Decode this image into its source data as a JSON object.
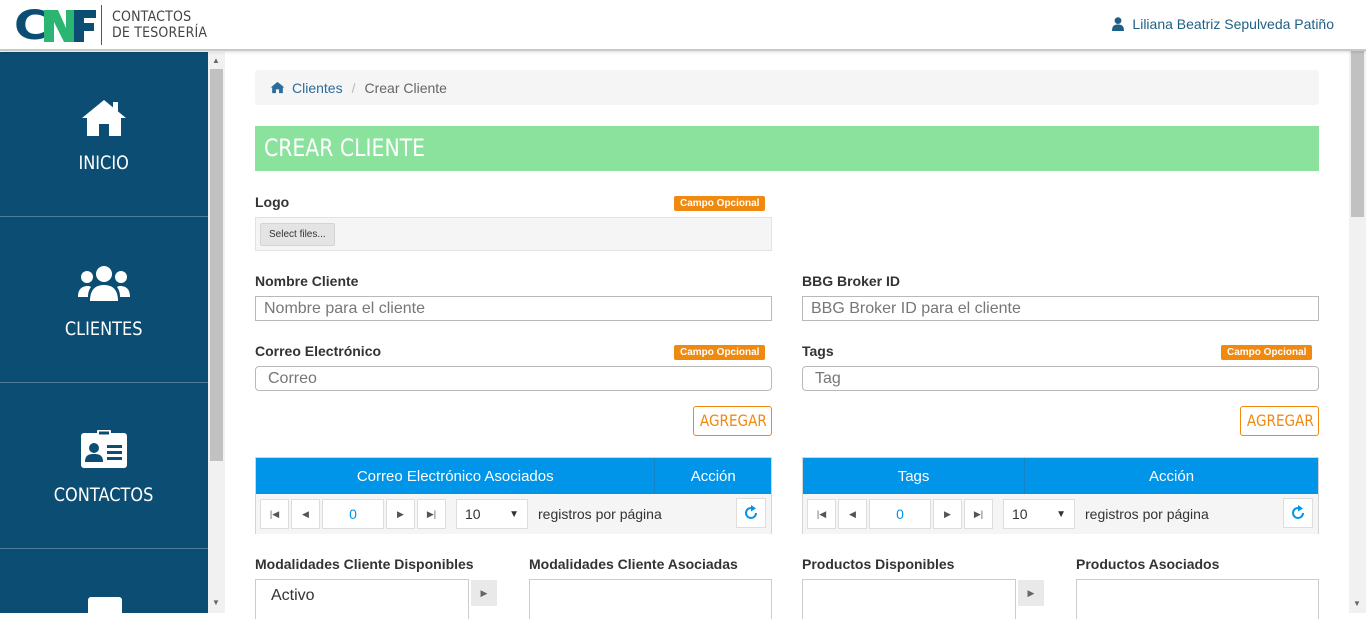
{
  "header": {
    "logo_text": "CAF",
    "app_title_line1": "CONTACTOS",
    "app_title_line2": "DE TESORERÍA",
    "user_name": "Liliana Beatriz Sepulveda Patiño"
  },
  "sidebar": {
    "items": [
      {
        "label": "INICIO",
        "icon": "home-icon"
      },
      {
        "label": "CLIENTES",
        "icon": "users-icon"
      },
      {
        "label": "CONTACTOS",
        "icon": "contact-card-icon"
      }
    ]
  },
  "breadcrumb": {
    "home_label": "Clientes",
    "separator": "/",
    "current": "Crear Cliente"
  },
  "page_title": "CREAR CLIENTE",
  "form": {
    "logo_label": "Logo",
    "optional_badge": "Campo Opcional",
    "file_button": "Select files...",
    "nombre_label": "Nombre Cliente",
    "nombre_placeholder": "Nombre para el cliente",
    "bbg_label": "BBG Broker ID",
    "bbg_placeholder": "BBG Broker ID para el cliente",
    "correo_label": "Correo Electrónico",
    "correo_placeholder": "Correo",
    "tags_label": "Tags",
    "tags_placeholder": "Tag",
    "agregar_button": "AGREGAR"
  },
  "grid_correos": {
    "columns": [
      "Correo Electrónico Asociados",
      "Acción"
    ],
    "page_value": "0",
    "page_size": "10",
    "per_page_text": "registros por página"
  },
  "grid_tags": {
    "columns": [
      "Tags",
      "Acción"
    ],
    "page_value": "0",
    "page_size": "10",
    "per_page_text": "registros por página"
  },
  "lists": {
    "modalidades_disponibles_label": "Modalidades Cliente Disponibles",
    "modalidades_asociadas_label": "Modalidades Cliente Asociadas",
    "productos_disponibles_label": "Productos Disponibles",
    "productos_asociados_label": "Productos Asociados",
    "modalidades_disponibles_items": [
      "Activo"
    ]
  },
  "colors": {
    "sidebar": "#0b4d73",
    "title_bar": "#8be29d",
    "grid_header": "#0095e8",
    "accent_orange": "#f0890f",
    "link_blue": "#2a6c9c"
  }
}
